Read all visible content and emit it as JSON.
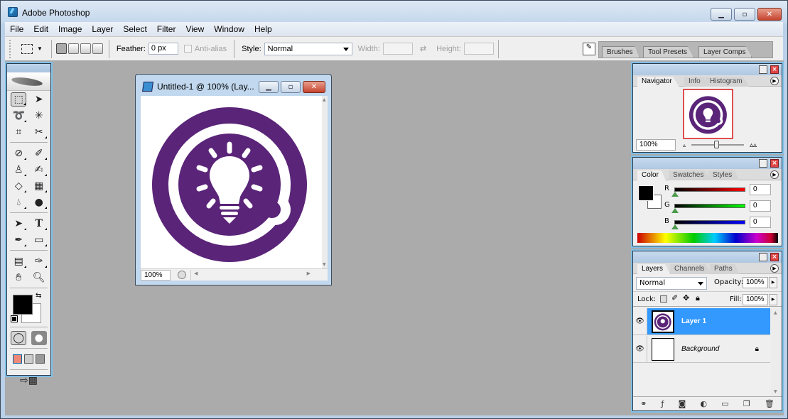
{
  "app": {
    "title": "Adobe Photoshop"
  },
  "menu": [
    "File",
    "Edit",
    "Image",
    "Layer",
    "Select",
    "Filter",
    "View",
    "Window",
    "Help"
  ],
  "options": {
    "feather_label": "Feather:",
    "feather_value": "0 px",
    "antialias_label": "Anti-alias",
    "style_label": "Style:",
    "style_value": "Normal",
    "width_label": "Width:",
    "height_label": "Height:"
  },
  "palette_well": {
    "tabs": [
      "Brushes",
      "Tool Presets",
      "Layer Comps"
    ]
  },
  "document": {
    "title": "Untitled-1 @ 100% (Lay...",
    "zoom": "100%",
    "image_color": "#5a2478"
  },
  "navigator": {
    "tabs": [
      "Navigator",
      "Info",
      "Histogram"
    ],
    "zoom": "100%",
    "view_box_color": "#e05050"
  },
  "color": {
    "tabs": [
      "Color",
      "Swatches",
      "Styles"
    ],
    "channels": [
      {
        "label": "R",
        "value": "0"
      },
      {
        "label": "G",
        "value": "0"
      },
      {
        "label": "B",
        "value": "0"
      }
    ],
    "foreground": "#000000",
    "background": "#ffffff"
  },
  "layers": {
    "tabs": [
      "Layers",
      "Channels",
      "Paths"
    ],
    "blend_mode": "Normal",
    "opacity_label": "Opacity:",
    "opacity": "100%",
    "lock_label": "Lock:",
    "fill_label": "Fill:",
    "fill": "100%",
    "items": [
      {
        "name": "Layer 1",
        "selected": true
      },
      {
        "name": "Background",
        "selected": false,
        "locked": true
      }
    ]
  },
  "toolbox": {
    "foreground": "#000000",
    "background": "#ffffff"
  }
}
